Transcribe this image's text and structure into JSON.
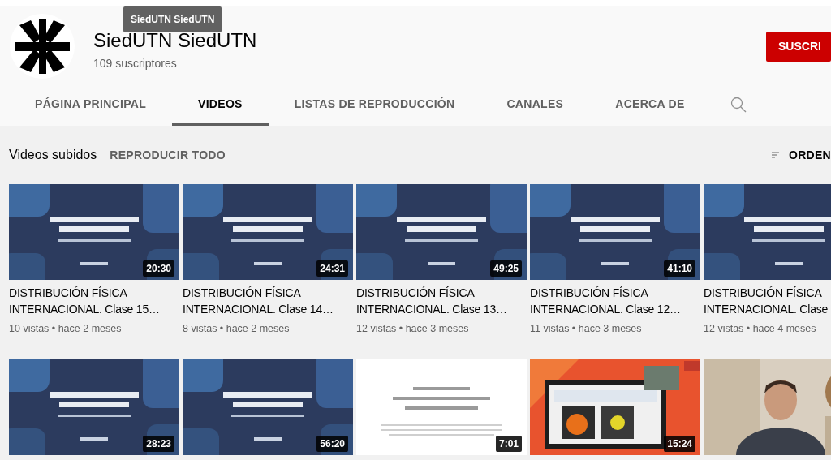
{
  "tooltip": "SiedUTN SiedUTN",
  "channel": {
    "name": "SiedUTN SiedUTN",
    "subscribers": "109 suscriptores",
    "subscribe_button": "SUSCRI"
  },
  "tabs": [
    {
      "label": "PÁGINA PRINCIPAL",
      "selected": false
    },
    {
      "label": "VIDEOS",
      "selected": true
    },
    {
      "label": "LISTAS DE REPRODUCCIÓN",
      "selected": false
    },
    {
      "label": "CANALES",
      "selected": false
    },
    {
      "label": "ACERCA DE",
      "selected": false
    }
  ],
  "section": {
    "title": "Videos subidos",
    "play_all": "REPRODUCIR TODO",
    "sort": "ORDEN"
  },
  "videos": [
    {
      "kind": "slide",
      "duration": "20:30",
      "title": "DISTRIBUCIÓN FÍSICA INTERNACIONAL. Clase 15…",
      "meta": "10 vistas • hace 2 meses"
    },
    {
      "kind": "slide",
      "duration": "24:31",
      "title": "DISTRIBUCIÓN FÍSICA INTERNACIONAL. Clase 14…",
      "meta": "8 vistas • hace 2 meses"
    },
    {
      "kind": "slide",
      "duration": "49:25",
      "title": "DISTRIBUCIÓN FÍSICA INTERNACIONAL. Clase 13…",
      "meta": "12 vistas • hace 3 meses"
    },
    {
      "kind": "slide",
      "duration": "41:10",
      "title": "DISTRIBUCIÓN FÍSICA INTERNACIONAL. Clase 12…",
      "meta": "11 vistas • hace 3 meses"
    },
    {
      "kind": "slide",
      "title": "DISTRIBUCIÓN FÍSICA INTERNACIONAL. Clase",
      "meta": "12 vistas • hace 4 meses"
    },
    {
      "kind": "slide",
      "duration": "28:23"
    },
    {
      "kind": "slide",
      "duration": "56:20"
    },
    {
      "kind": "document",
      "duration": "7:01"
    },
    {
      "kind": "lab",
      "duration": "15:24"
    },
    {
      "kind": "webcam"
    }
  ]
}
